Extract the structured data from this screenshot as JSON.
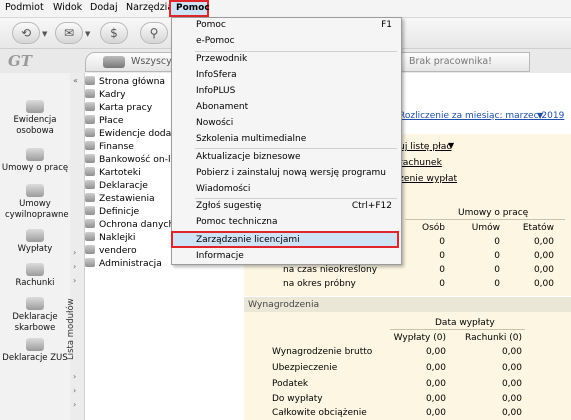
{
  "menubar": {
    "items": [
      "Podmiot",
      "Widok",
      "Dodaj",
      "Narzędzia"
    ],
    "active": "Pomoc"
  },
  "toolbar": {
    "icons": [
      "back-icon",
      "mail-icon",
      "money-icon",
      "search-icon"
    ]
  },
  "app": {
    "logo": "GT"
  },
  "tabs": {
    "workers_tab": "Wszyscy",
    "search_placeholder": "Brak pracownika!"
  },
  "left_toolbar": [
    "Ewidencja osobowa",
    "Umowy o pracę",
    "Umowy cywilnoprawne",
    "Wypłaty",
    "Rachunki",
    "Deklaracje skarbowe",
    "Deklaracje ZUS"
  ],
  "modules_label": "Lista modułów",
  "modules": [
    "Strona główna",
    "Kadry",
    "Karta pracy",
    "Płace",
    "Ewidencje dodatkowe",
    "Finanse",
    "Bankowość on-line",
    "Kartoteki",
    "Deklaracje",
    "Zestawienia",
    "Definicje",
    "Ochrona danych",
    "Naklejki",
    "vendero",
    "Administracja"
  ],
  "main": {
    "period": "Rozliczenie za miesiąc: marzec 2019",
    "links": [
      "uj listę płac",
      "rachunek",
      "zenie wypłat"
    ],
    "contracts": {
      "group_header": "Umowy o pracę",
      "columns": [
        "Osób",
        "Umów",
        "Etatów"
      ],
      "rows": [
        {
          "label": "",
          "values": [
            "0",
            "0",
            "0,00"
          ]
        },
        {
          "label": "",
          "values": [
            "0",
            "0",
            "0,00"
          ]
        },
        {
          "label": "",
          "values": [
            "0",
            "0",
            "0,00"
          ]
        },
        {
          "label": "na czas nieokreślony",
          "values": [
            "0",
            "0",
            "0,00"
          ]
        },
        {
          "label": "na okres próbny",
          "values": [
            "0",
            "0",
            "0,00"
          ]
        }
      ]
    },
    "salaries": {
      "title": "Wynagrodzenia",
      "group_header": "Data wypłaty",
      "columns": [
        "Wypłaty (0)",
        "Rachunki (0)"
      ],
      "rows": [
        {
          "label": "Wynagrodzenie brutto",
          "values": [
            "0,00",
            "0,00"
          ]
        },
        {
          "label": "Ubezpieczenie",
          "values": [
            "0,00",
            "0,00"
          ]
        },
        {
          "label": "Podatek",
          "values": [
            "0,00",
            "0,00"
          ]
        },
        {
          "label": "Do wypłaty",
          "values": [
            "0,00",
            "0,00"
          ]
        },
        {
          "label": "Całkowite obciążenie",
          "values": [
            "0,00",
            "0,00"
          ]
        }
      ]
    }
  },
  "help_menu": {
    "items": [
      {
        "label": "Pomoc",
        "shortcut": "F1"
      },
      {
        "label": "e-Pomoc",
        "shortcut": ""
      },
      {
        "label": "Przewodnik",
        "shortcut": ""
      },
      {
        "label": "InfoSfera",
        "shortcut": ""
      },
      {
        "label": "InfoPLUS",
        "shortcut": ""
      },
      {
        "label": "Abonament",
        "shortcut": ""
      },
      {
        "label": "Nowości",
        "shortcut": ""
      },
      {
        "label": "Szkolenia multimedialne",
        "shortcut": ""
      },
      {
        "label": "Aktualizacje biznesowe",
        "shortcut": ""
      },
      {
        "label": "Pobierz i zainstaluj nową wersję programu",
        "shortcut": ""
      },
      {
        "label": "Wiadomości",
        "shortcut": ""
      },
      {
        "label": "Zgłoś sugestię",
        "shortcut": "Ctrl+F12"
      },
      {
        "label": "Pomoc techniczna",
        "shortcut": ""
      },
      {
        "label": "Zarządzanie licencjami",
        "shortcut": ""
      },
      {
        "label": "Informacje",
        "shortcut": ""
      }
    ]
  },
  "colors": {
    "highlight": "#cfe3f7",
    "annotation_red": "#e0262a",
    "panel_bg": "#fcf6e2",
    "link_blue": "#1f4fa8"
  }
}
